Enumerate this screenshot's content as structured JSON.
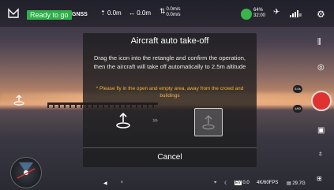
{
  "topbar": {
    "status": "Ready to go",
    "gnss": "GNSS",
    "height_value": "0.0m",
    "distance_value": "0.0m",
    "speed_h": "0.0m/s",
    "speed_v": "0.0m/s",
    "battery_pct": "64%",
    "battery_time": "32:00"
  },
  "dialog": {
    "title": "Aircraft auto take-off",
    "message": "Drag the icon into the retangle and confirm the operation, then the aircraft will take off automatically to 2.5m altitude",
    "warning": "* Please fly in the open and empty area, away from the crowd and buildings",
    "arrows": "›››",
    "cancel_label": "Cancel"
  },
  "right": {
    "mode_top": "5.0s",
    "mode_bottom": "1/60"
  },
  "bottom": {
    "ev": "0.0",
    "format": "4K/60FPS",
    "storage": "29.7G"
  },
  "colors": {
    "status_green": "#2fae4a",
    "warning_amber": "#f2b33b",
    "record_red": "#e0332f"
  }
}
